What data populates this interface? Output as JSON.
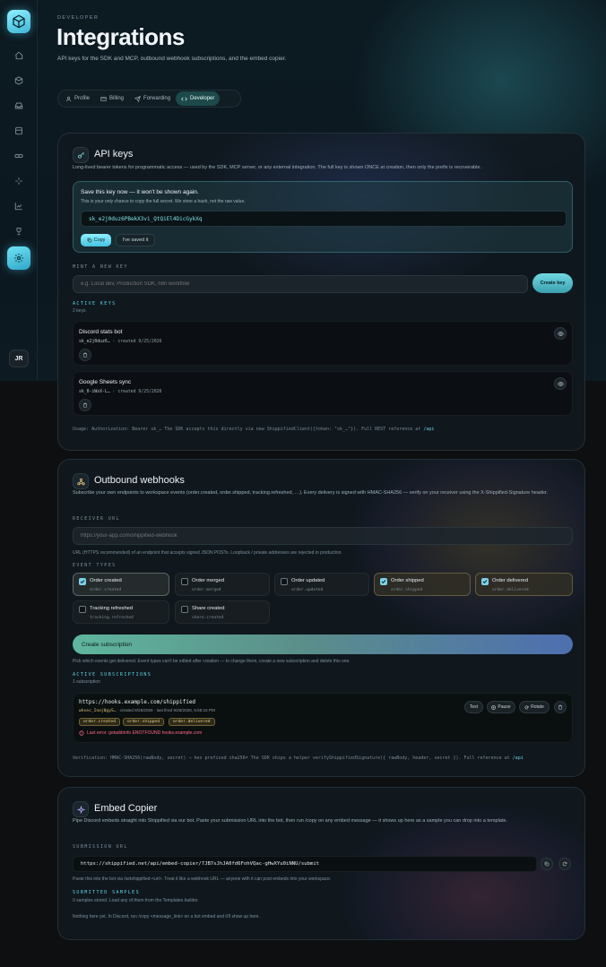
{
  "sidebar": {
    "icons": [
      "home-icon",
      "box-icon",
      "inbox-icon",
      "database-icon",
      "link-icon",
      "sparkle-icon",
      "chart-icon",
      "trophy-icon",
      "settings-icon"
    ],
    "avatar": "JR"
  },
  "header": {
    "eyebrow": "DEVELOPER",
    "title": "Integrations",
    "description": "API keys for the SDK and MCP, outbound webhook subscriptions, and the embed copier."
  },
  "tabs": [
    {
      "label": "Profile",
      "icon": "user-icon"
    },
    {
      "label": "Billing",
      "icon": "card-icon"
    },
    {
      "label": "Forwarding",
      "icon": "send-icon"
    },
    {
      "label": "Developer",
      "icon": "code-icon",
      "active": true
    }
  ],
  "api_keys": {
    "title": "API keys",
    "description": "Long-lived bearer tokens for programmatic access — used by the SDK, MCP server, or any external integration. The full key is shown ONCE at creation, then only the prefix is recoverable.",
    "save_notice": {
      "title": "Save this key now — it won't be shown again.",
      "subtitle": "This is your only chance to copy the full secret. We store a hash, not the raw value.",
      "key": "sk_e2j0duz6PBekX3vi_QtQiEl4DicGykXq",
      "copy_label": "Copy",
      "saved_label": "I've saved it"
    },
    "mint_label": "MINT A NEW KEY",
    "mint_placeholder": "e.g. Local dev, Production SDK, n8n workflow",
    "create_label": "Create key",
    "active_label": "ACTIVE KEYS",
    "active_count": "2 keys",
    "keys": [
      {
        "name": "Discord stats bot",
        "prefix": "sk_e2j0duz6…",
        "created": "created 9/25/2026"
      },
      {
        "name": "Google Sheets sync",
        "prefix": "sk_0-iWsX-L…",
        "created": "created 9/25/2026"
      }
    ],
    "usage_prefix": "Usage: Authorization: Bearer sk_… The SDK accepts this directly via new ShippifiedClient({token: \"sk_…\"}). Full REST reference at ",
    "usage_link": "/api"
  },
  "webhooks": {
    "title": "Outbound webhooks",
    "description": "Subscribe your own endpoints to workspace events (order.created, order.shipped, tracking.refreshed, …). Every delivery is signed with HMAC-SHA256 — verify on your receiver using the X-Shippified-Signature header.",
    "receiver_label": "RECEIVER URL",
    "receiver_placeholder": "https://your-app.com/shippified-webhook",
    "receiver_note": "URL (HTTPS recommended) of an endpoint that accepts signed JSON POSTs. Loopback / private addresses are rejected in production.",
    "event_types_label": "EVENT TYPES",
    "events": [
      {
        "label": "Order created",
        "code": "order.created",
        "checked": true
      },
      {
        "label": "Order merged",
        "code": "order.merged",
        "checked": false
      },
      {
        "label": "Order updated",
        "code": "order.updated",
        "checked": false
      },
      {
        "label": "Order shipped",
        "code": "order.shipped",
        "checked": true
      },
      {
        "label": "Order delivered",
        "code": "order.delivered",
        "checked": true
      },
      {
        "label": "Tracking refreshed",
        "code": "tracking.refreshed",
        "checked": false
      },
      {
        "label": "Share created",
        "code": "share.created",
        "checked": false
      }
    ],
    "create_label": "Create subscription",
    "create_note": "Pick which events get delivered. Event types can't be edited after creation — to change them, create a new subscription and delete this one.",
    "active_label": "ACTIVE SUBSCRIPTIONS",
    "active_count": "1 subscription",
    "subscription": {
      "url": "https://hooks.example.com/shippified",
      "prefix": "whsec_Inoj0gyS…",
      "meta": " · created 9/25/2026 · last fired 9/25/2026, 5:55:24 PM",
      "chips": [
        "order.created",
        "order.shipped",
        "order.delivered"
      ],
      "error": "Last error: getaddrinfo ENOTFOUND hooks.example.com",
      "actions": [
        "Test",
        "Pause",
        "Rotate"
      ]
    },
    "verification_prefix": "Verification: HMAC-SHA256(rawBody, secret) → hex prefixed sha256= The SDK ships a helper verifyShippifiedSignature({ rawBody, header, secret }). Full reference at ",
    "verification_link": "/api"
  },
  "embed": {
    "title": "Embed Copier",
    "description": "Pipe Discord embeds straight into Shippified via our bot. Paste your submission URL into the bot, then run /copy on any embed message — it shows up here as a sample you can drop into a template.",
    "url_label": "SUBMISSION URL",
    "url": "https://shippified.net/api/embed-copier/7JB7sJhJA0fd6FohVQac-gHwXYu0iNNU/submit",
    "url_note": "Paste this into the bot via /setshippified-<url>. Treat it like a webhook URL — anyone with it can post embeds into your workspace.",
    "samples_label": "SUBMITTED SAMPLES",
    "samples_note": "0 samples stored. Load any of them from the Templates builder.",
    "empty_note": "Nothing here yet. In Discord, run /copy <message_link> on a bot embed and it'll show up here."
  },
  "colors": {
    "accent": "#5fd6e6",
    "error": "#ff6b8a",
    "chip": "#e6cf8a"
  }
}
